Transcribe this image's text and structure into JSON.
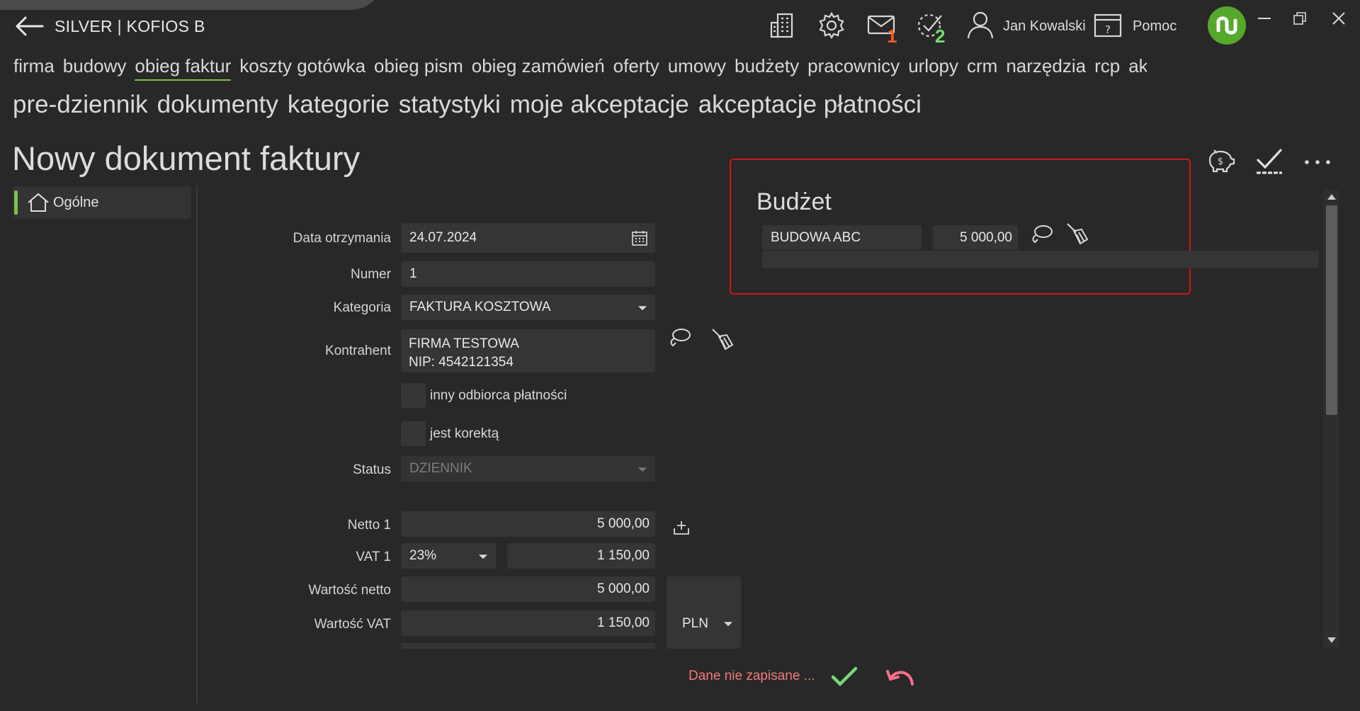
{
  "app": {
    "title": "SILVER | KOFIOS B",
    "user_name": "Jan Kowalski",
    "help_label": "Pomoc",
    "mail_count": "1",
    "tasks_count": "2"
  },
  "nav": {
    "main": [
      "firma",
      "budowy",
      "obieg faktur",
      "koszty gotówka",
      "obieg pism",
      "obieg zamówień",
      "oferty",
      "umowy",
      "budżety",
      "pracownicy",
      "urlopy",
      "crm",
      "narzędzia",
      "rcp",
      "akceptacje"
    ],
    "active_index": 2,
    "sub": [
      "pre-dziennik",
      "dokumenty",
      "kategorie",
      "statystyki",
      "moje akceptacje",
      "akceptacje płatności"
    ]
  },
  "page": {
    "title": "Nowy dokument faktury"
  },
  "sidebar": {
    "items": [
      {
        "label": "Ogólne",
        "icon": "home-icon"
      }
    ]
  },
  "form": {
    "date_label": "Data otrzymania",
    "date_value": "24.07.2024",
    "number_label": "Numer",
    "number_value": "1",
    "category_label": "Kategoria",
    "category_value": "FAKTURA KOSZTOWA",
    "contractor_label": "Kontrahent",
    "contractor_line1": "FIRMA TESTOWA",
    "contractor_line2": "NIP: 4542121354",
    "other_payee_label": "inny odbiorca płatności",
    "correction_label": "jest korektą",
    "status_label": "Status",
    "status_value": "DZIENNIK",
    "netto1_label": "Netto 1",
    "netto1_value": "5 000,00",
    "vat1_label": "VAT 1",
    "vat1_rate": "23%",
    "vat1_value": "1 150,00",
    "net_total_label": "Wartość netto",
    "net_total_value": "5 000,00",
    "vat_total_label": "Wartość VAT",
    "vat_total_value": "1 150,00",
    "currency": "PLN"
  },
  "budget": {
    "title": "Budżet",
    "name": "BUDOWA ABC",
    "amount": "5 000,00"
  },
  "footer": {
    "status_text": "Dane nie zapisane ..."
  },
  "colors": {
    "accent_green": "#7bc24a",
    "alert_red": "#d01616",
    "badge_orange": "#ff5a1f",
    "badge_green": "#6ee06e",
    "unsaved_text": "#f07a7a",
    "undo_pink": "#ff6f8a"
  }
}
